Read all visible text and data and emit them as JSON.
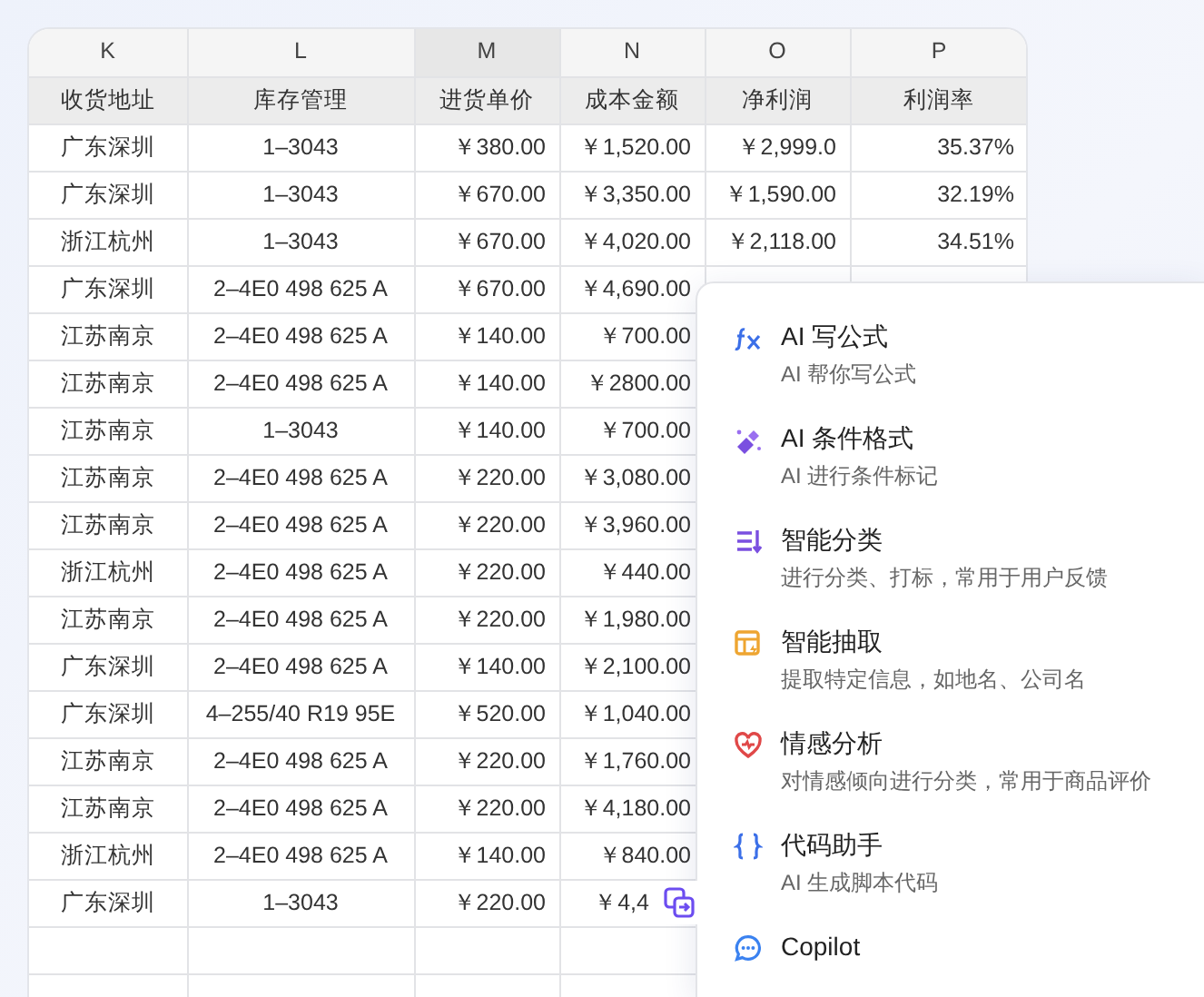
{
  "columns": [
    {
      "letter": "K",
      "selected": false
    },
    {
      "letter": "L",
      "selected": false
    },
    {
      "letter": "M",
      "selected": true
    },
    {
      "letter": "N",
      "selected": false
    },
    {
      "letter": "O",
      "selected": false
    },
    {
      "letter": "P",
      "selected": false
    }
  ],
  "headers": [
    "收货地址",
    "库存管理",
    "进货单价",
    "成本金额",
    "净利润",
    "利润率"
  ],
  "rows": [
    [
      "广东深圳",
      "1–3043",
      "￥380.00",
      "￥1,520.00",
      "￥2,999.0",
      "35.37%"
    ],
    [
      "广东深圳",
      "1–3043",
      "￥670.00",
      "￥3,350.00",
      "￥1,590.00",
      "32.19%"
    ],
    [
      "浙江杭州",
      "1–3043",
      "￥670.00",
      "￥4,020.00",
      "￥2,118.00",
      "34.51%"
    ],
    [
      "广东深圳",
      "2–4E0 498 625 A",
      "￥670.00",
      "￥4,690.00",
      null,
      null
    ],
    [
      "江苏南京",
      "2–4E0 498 625 A",
      "￥140.00",
      "￥700.00",
      null,
      null
    ],
    [
      "江苏南京",
      "2–4E0 498 625 A",
      "￥140.00",
      "￥2800.00",
      null,
      null
    ],
    [
      "江苏南京",
      "1–3043",
      "￥140.00",
      "￥700.00",
      null,
      null
    ],
    [
      "江苏南京",
      "2–4E0 498 625 A",
      "￥220.00",
      "￥3,080.00",
      null,
      null
    ],
    [
      "江苏南京",
      "2–4E0 498 625 A",
      "￥220.00",
      "￥3,960.00",
      null,
      null
    ],
    [
      "浙江杭州",
      "2–4E0 498 625 A",
      "￥220.00",
      "￥440.00",
      null,
      null
    ],
    [
      "江苏南京",
      "2–4E0 498 625 A",
      "￥220.00",
      "￥1,980.00",
      null,
      null
    ],
    [
      "广东深圳",
      "2–4E0 498 625 A",
      "￥140.00",
      "￥2,100.00",
      null,
      null
    ],
    [
      "广东深圳",
      "4–255/40 R19 95E",
      "￥520.00",
      "￥1,040.00",
      null,
      null
    ],
    [
      "江苏南京",
      "2–4E0 498 625 A",
      "￥220.00",
      "￥1,760.00",
      null,
      null
    ],
    [
      "江苏南京",
      "2–4E0 498 625 A",
      "￥220.00",
      "￥4,180.00",
      null,
      null
    ],
    [
      "浙江杭州",
      "2–4E0 498 625 A",
      "￥140.00",
      "￥840.00",
      null,
      null
    ],
    [
      "广东深圳",
      "1–3043",
      "￥220.00",
      "￥4,4",
      null,
      null
    ]
  ],
  "menu": [
    {
      "kind": "formula",
      "title": "AI 写公式",
      "description": "AI 帮你写公式"
    },
    {
      "kind": "format",
      "title": "AI 条件格式",
      "description": "AI 进行条件标记"
    },
    {
      "kind": "classify",
      "title": "智能分类",
      "description": "进行分类、打标，常用于用户反馈"
    },
    {
      "kind": "extract",
      "title": "智能抽取",
      "description": "提取特定信息，如地名、公司名"
    },
    {
      "kind": "sentiment",
      "title": "情感分析",
      "description": "对情感倾向进行分类，常用于商品评价"
    },
    {
      "kind": "code",
      "title": "代码助手",
      "description": "AI 生成脚本代码"
    },
    {
      "kind": "chat",
      "title": "Copilot"
    }
  ]
}
